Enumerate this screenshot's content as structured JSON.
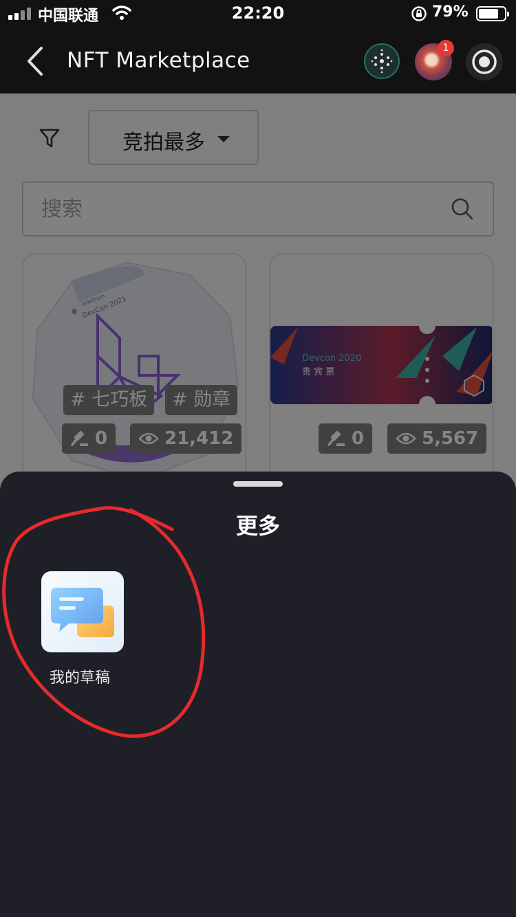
{
  "status_bar": {
    "carrier": "中国联通",
    "time": "22:20",
    "battery_percent": "79%",
    "battery_level": 0.79
  },
  "nav": {
    "title": "NFT Marketplace",
    "notification_count": "1"
  },
  "toolbar": {
    "sort_value": "竞拍最多"
  },
  "search": {
    "placeholder": "搜索"
  },
  "cards": [
    {
      "badge_text": [
        "Arbitrum",
        "DevCon 2021"
      ],
      "tags": [
        "# 七巧板",
        "# 勋章"
      ],
      "bids": "0",
      "views": "21,412"
    },
    {
      "ticket_title": "Devcon 2020",
      "ticket_subtitle": "贵 宾 票",
      "bids": "0",
      "views": "5,567"
    }
  ],
  "sheet": {
    "title": "更多",
    "items": [
      {
        "label": "我的草稿",
        "icon": "chat-bubbles-icon"
      }
    ]
  },
  "colors": {
    "annotation": "#e52b2b",
    "sheet_bg": "#1f1f27",
    "nav_bg": "#121212"
  }
}
